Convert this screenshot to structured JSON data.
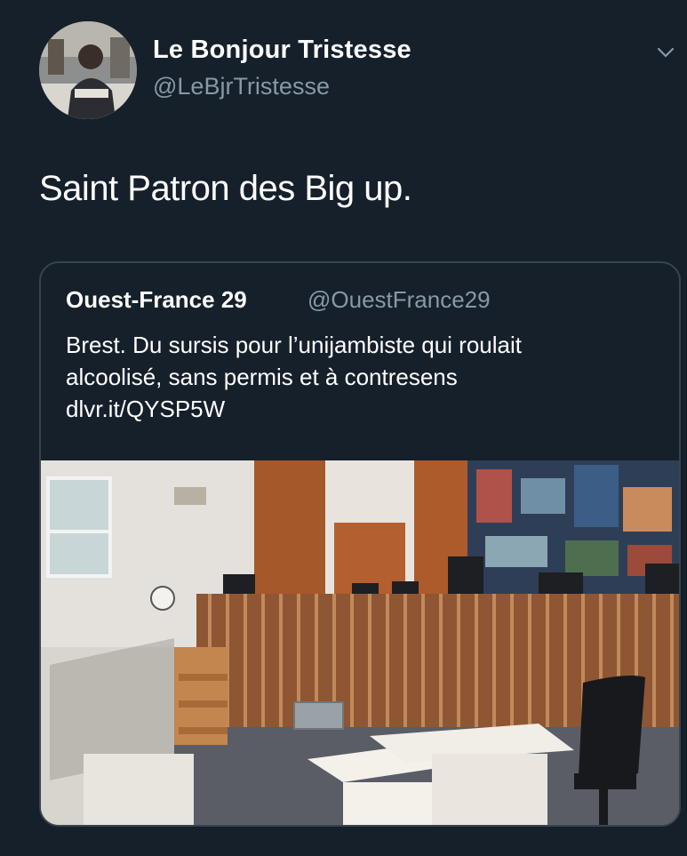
{
  "tweet": {
    "author_name": "Le Bonjour Tristesse",
    "author_handle": "@LeBjrTristesse",
    "text": "Saint Patron des Big up."
  },
  "quoted_tweet": {
    "author_name": "Ouest-France 29",
    "author_handle": "@OuestFrance29",
    "text_lines": [
      "Brest. Du sursis pour l’unijambiste qui roulait",
      "alcoolisé, sans permis et à contresens",
      "dlvr.it/QYSP5W"
    ]
  },
  "icons": {
    "menu": "chevron-down-icon",
    "avatar": "avatar"
  },
  "colors": {
    "background": "#15202b",
    "secondary_text": "#8899a6",
    "border": "#38444d"
  }
}
